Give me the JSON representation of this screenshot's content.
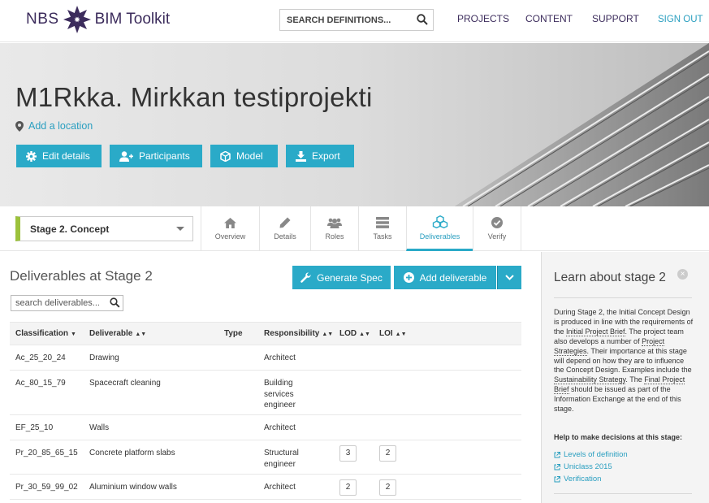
{
  "header": {
    "logo_left": "NBS",
    "logo_right": "BIM Toolkit",
    "search_placeholder": "SEARCH DEFINITIONS...",
    "nav": {
      "projects": "PROJECTS",
      "content": "CONTENT",
      "support": "SUPPORT",
      "signout": "SIGN OUT"
    }
  },
  "project": {
    "title": "M1Rkka. Mirkkan testiprojekti",
    "location_link": "Add a location",
    "buttons": {
      "edit": "Edit details",
      "participants": "Participants",
      "model": "Model",
      "export": "Export"
    }
  },
  "stage_select": {
    "selected": "Stage 2. Concept"
  },
  "tabs": {
    "overview": "Overview",
    "details": "Details",
    "roles": "Roles",
    "tasks": "Tasks",
    "deliverables": "Deliverables",
    "verify": "Verify"
  },
  "main": {
    "title": "Deliverables at Stage 2",
    "generate_spec": "Generate Spec",
    "add_deliverable": "Add deliverable",
    "search_placeholder": "search deliverables...",
    "columns": {
      "classification": "Classification",
      "deliverable": "Deliverable",
      "type": "Type",
      "responsibility": "Responsibility",
      "lod": "LOD",
      "loi": "LOI"
    },
    "rows": [
      {
        "classification": "Ac_25_20_24",
        "deliverable": "Drawing",
        "type": "",
        "responsibility": "Architect",
        "lod": "",
        "loi": ""
      },
      {
        "classification": "Ac_80_15_79",
        "deliverable": "Spacecraft cleaning",
        "type": "",
        "responsibility": "Building services engineer",
        "lod": "",
        "loi": ""
      },
      {
        "classification": "EF_25_10",
        "deliverable": "Walls",
        "type": "",
        "responsibility": "Architect",
        "lod": "",
        "loi": ""
      },
      {
        "classification": "Pr_20_85_65_15",
        "deliverable": "Concrete platform slabs",
        "type": "",
        "responsibility": "Structural engineer",
        "lod": "3",
        "loi": "2"
      },
      {
        "classification": "Pr_30_59_99_02",
        "deliverable": "Aluminium window walls",
        "type": "",
        "responsibility": "Architect",
        "lod": "2",
        "loi": "2"
      }
    ]
  },
  "sidebar": {
    "title": "Learn about stage 2",
    "body": {
      "p1": "During Stage 2, the Initial Concept Design is produced in line with the requirements of the ",
      "l1": "Initial Project Brief",
      "p2": ". The project team also develops a number of ",
      "l2": "Project Strategies",
      "p3": ". Their importance at this stage will depend on how they are to influence the Concept Design. Examples include the ",
      "l3": "Sustainability Strategy",
      "p4": ". The ",
      "l4": "Final Project Brief",
      "p5": " should be issued as part of the Information Exchange at the end of this stage."
    },
    "help_title": "Help to make decisions at this stage:",
    "links": [
      "Levels of definition",
      "Uniclass 2015",
      "Verification"
    ]
  },
  "colors": {
    "accent": "#2aaac8",
    "brand": "#3c2c5c",
    "stage_bar": "#9cc23c"
  }
}
